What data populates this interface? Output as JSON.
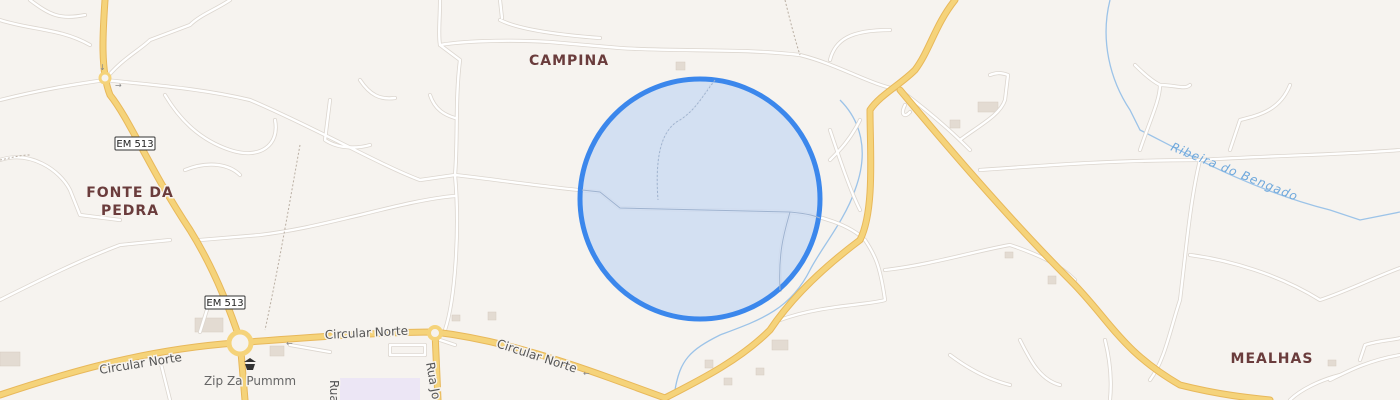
{
  "places": {
    "campina": "CAMPINA",
    "fonte_da_pedra_line1": "FONTE DA",
    "fonte_da_pedra_line2": "PEDRA",
    "mealhas": "MEALHAS"
  },
  "roads": {
    "em513_a": "EM 513",
    "em513_b": "EM 513",
    "circular_norte_1": "Circular Norte",
    "circular_norte_2": "Circular Norte",
    "circular_norte_3": "Circular Norte",
    "rua_1": "Rua",
    "rua_jo": "Rua Jo"
  },
  "water": {
    "ribeira": "Ribeira do Bengado"
  },
  "poi": {
    "zip_za": "Zip Za Pummm",
    "zip_za_icon": "amusement-icon"
  },
  "colors": {
    "background": "#f6f3ef",
    "major_road": "#f5d37a",
    "major_road_casing": "#e8b85a",
    "minor_road": "#ffffff",
    "minor_road_casing": "#dcd6cf",
    "water": "#9cc3e8",
    "highlight_fill": "#cddcf2",
    "highlight_stroke": "#3b87ec",
    "place_label": "#6a3c3c"
  }
}
